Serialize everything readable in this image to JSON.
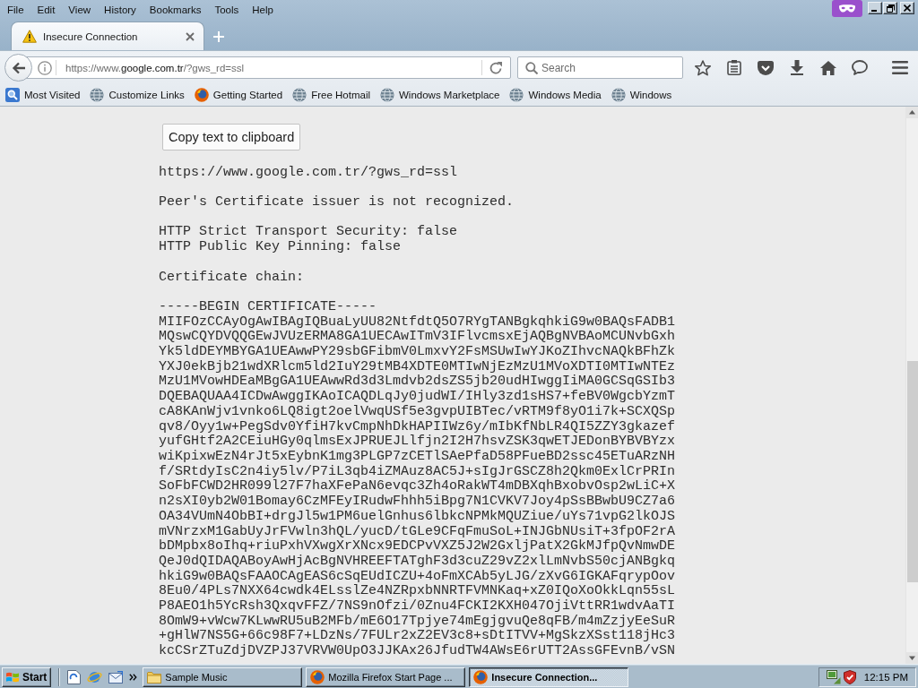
{
  "menu_bar": {
    "items": [
      "File",
      "Edit",
      "View",
      "History",
      "Bookmarks",
      "Tools",
      "Help"
    ]
  },
  "tabs": [
    {
      "label": "Insecure Connection",
      "selected": true
    }
  ],
  "address_bar": {
    "url_start": "https://www.",
    "url_domain": "google.com.tr",
    "url_end": "/?gws_rd=ssl"
  },
  "search": {
    "placeholder": "Search"
  },
  "bookmarks": [
    {
      "label": "Most Visited",
      "kind": "smart"
    },
    {
      "label": "Customize Links",
      "kind": "globe"
    },
    {
      "label": "Getting Started",
      "kind": "firefox"
    },
    {
      "label": "Free Hotmail",
      "kind": "globe"
    },
    {
      "label": "Windows Marketplace",
      "kind": "globe"
    },
    {
      "label": "Windows Media",
      "kind": "globe"
    },
    {
      "label": "Windows",
      "kind": "globe"
    }
  ],
  "page": {
    "copy_button": "Copy text to clipboard",
    "url_line": "https://www.google.com.tr/?gws_rd=ssl",
    "error_message": "Peer's Certificate issuer is not recognized.",
    "security_flags": [
      "HTTP Strict Transport Security: false",
      "HTTP Public Key Pinning: false"
    ],
    "chain_heading": "Certificate chain:",
    "certificate": [
      "-----BEGIN CERTIFICATE-----",
      "MIIFOzCCAyOgAwIBAgIQBuaLyUU82NtfdtQ5O7RYgTANBgkqhkiG9w0BAQsFADB1",
      "MQswCQYDVQQGEwJVUzERMA8GA1UECAwITmV3IFlvcmsxEjAQBgNVBAoMCUNvbGxh",
      "Yk5ldDEYMBYGA1UEAwwPY29sbGFibmV0LmxvY2FsMSUwIwYJKoZIhvcNAQkBFhZk",
      "YXJ0ekBjb21wdXRlcm5ld2IuY29tMB4XDTE0MTIwNjEzMzU1MVoXDTI0MTIwNTEz",
      "MzU1MVowHDEaMBgGA1UEAwwRd3d3Lmdvb2dsZS5jb20udHIwggIiMA0GCSqGSIb3",
      "DQEBAQUAA4ICDwAwggIKAoICAQDLqJy0judWI/IHly3zd1sHS7+feBV0WgcbYzmT",
      "cA8KAnWjv1vnko6LQ8igt2oelVwqUSf5e3gvpUIBTec/vRTM9f8yO1i7k+SCXQSp",
      "qv8/Oyy1w+PegSdv0YfiH7kvCmpNhDkHAPIIWz6y/mIbKfNbLR4QI5ZZY3gkazef",
      "yufGHtf2A2CEiuHGy0qlmsExJPRUEJLlfjn2I2H7hsvZSK3qwETJEDonBYBVBYzx",
      "wiKpixwEzN4rJt5xEybnK1mg3PLGP7zCETlSAePfaD58PFueBD2ssc45ETuARzNH",
      "f/SRtdyIsC2n4iy5lv/P7iL3qb4iZMAuz8AC5J+sIgJrGSCZ8h2Qkm0ExlCrPRIn",
      "SoFbFCWD2HR099l27F7haXFePaN6evqc3Zh4oRakWT4mDBXqhBxobvOsp2wLiC+X",
      "n2sXI0yb2W01Bomay6CzMFEyIRudwFhhh5iBpg7N1CVKV7Joy4pSsBBwbU9CZ7a6",
      "OA34VUmN4ObBI+drgJl5w1PM6uelGnhus6lbkcNPMkMQUZiue/uYs71vpG2lkOJS",
      "mVNrzxM1GabUyJrFVwln3hQL/yucD/tGLe9CFqFmuSoL+INJGbNUsiT+3fpOF2rA",
      "bDMpbx8oIhq+riuPxhVXwgXrXNcx9EDCPvVXZ5J2W2GxljPatX2GkMJfpQvNmwDE",
      "QeJ0dQIDAQABoyAwHjAcBgNVHREEFTATghF3d3cuZ29vZ2xlLmNvbS50cjANBgkq",
      "hkiG9w0BAQsFAAOCAgEAS6cSqEUdICZU+4oFmXCAb5yLJG/zXvG6IGKAFqrypOov",
      "8Eu0/4PLs7NXX64cwdk4ELsslZe4NZRpxbNNRTFVMNKaq+xZ0IQoXoOkkLqn55sL",
      "P8AEO1h5YcRsh3QxqvFFZ/7NS9nOfzi/0Znu4FCKI2KXH047OjiVttRR1wdvAaTI",
      "8OmW9+vWcw7KLwwRU5uB2MFb/mE6O17Tpjye74mEgjgvuQe8qFB/m4mZzjyEeSuR",
      "+gHlW7NS5G+66c98F7+LDzNs/7FULr2xZ2EV3c8+sDtITVV+MgSkzXSst118jHc3",
      "kcCSrZTuZdjDVZPJ37VRVW0UpO3JJKAx26JfudTW4AWsE6rUTT2AssGFEvnB/vSN"
    ]
  },
  "taskbar": {
    "start": "Start",
    "tasks": [
      {
        "label": "Sample Music",
        "kind": "folder",
        "selected": false
      },
      {
        "label": "Mozilla Firefox Start Page ...",
        "kind": "firefox",
        "selected": false
      },
      {
        "label": "Insecure Connection...",
        "kind": "firefox",
        "selected": true
      }
    ],
    "clock": "12:15 PM"
  }
}
